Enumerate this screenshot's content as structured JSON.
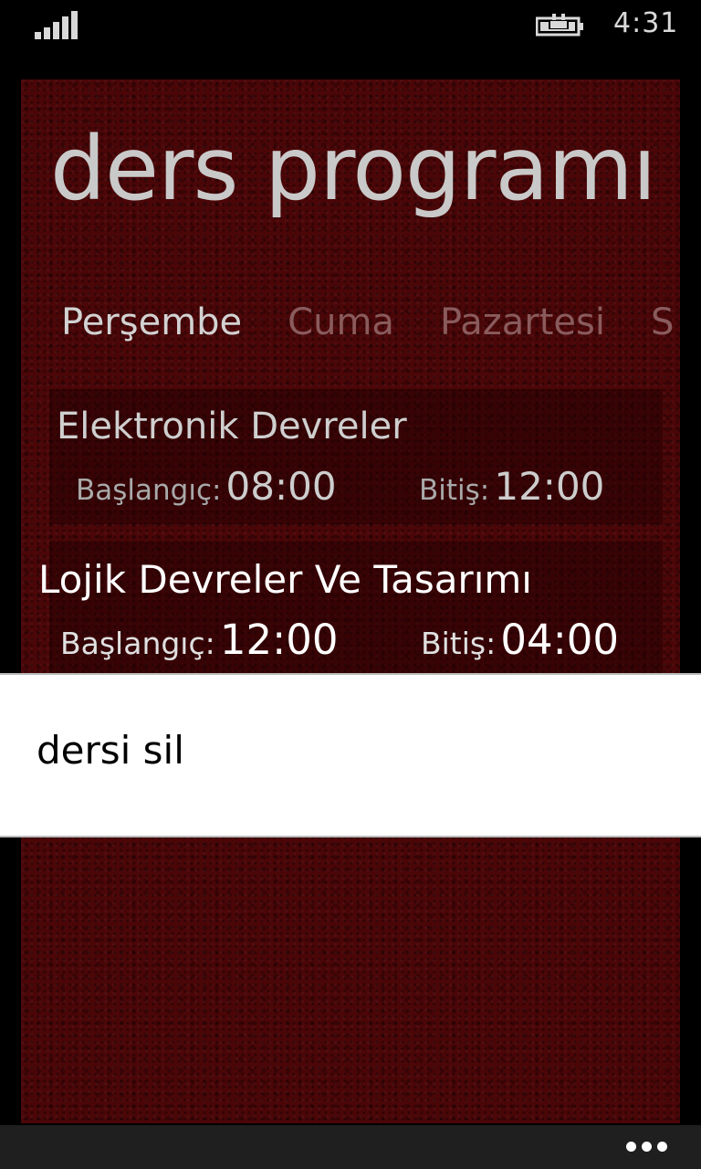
{
  "status": {
    "time": "4:31",
    "signal_icon": "signal-bars-icon",
    "battery_icon": "charging-battery-icon"
  },
  "app": {
    "title": "ders programı",
    "pivot": {
      "items": [
        "Perşembe",
        "Cuma",
        "Pazartesi",
        "S"
      ],
      "active_index": 0
    },
    "courses": [
      {
        "name": "Elektronik Devreler",
        "start_label": "Başlangıç:",
        "start": "08:00",
        "end_label": "Bitiş:",
        "end": "12:00"
      },
      {
        "name": "Lojik Devreler Ve Tasarımı",
        "start_label": "Başlangıç:",
        "start": "12:00",
        "end_label": "Bitiş:",
        "end": "04:00"
      }
    ]
  },
  "context_menu": {
    "items": [
      "dersi sil"
    ]
  },
  "appbar": {
    "more_icon": "more-dots-icon"
  },
  "colors": {
    "background": "#4b0608",
    "accent_text": "#c9c9c9",
    "menu_bg": "#ffffff"
  }
}
